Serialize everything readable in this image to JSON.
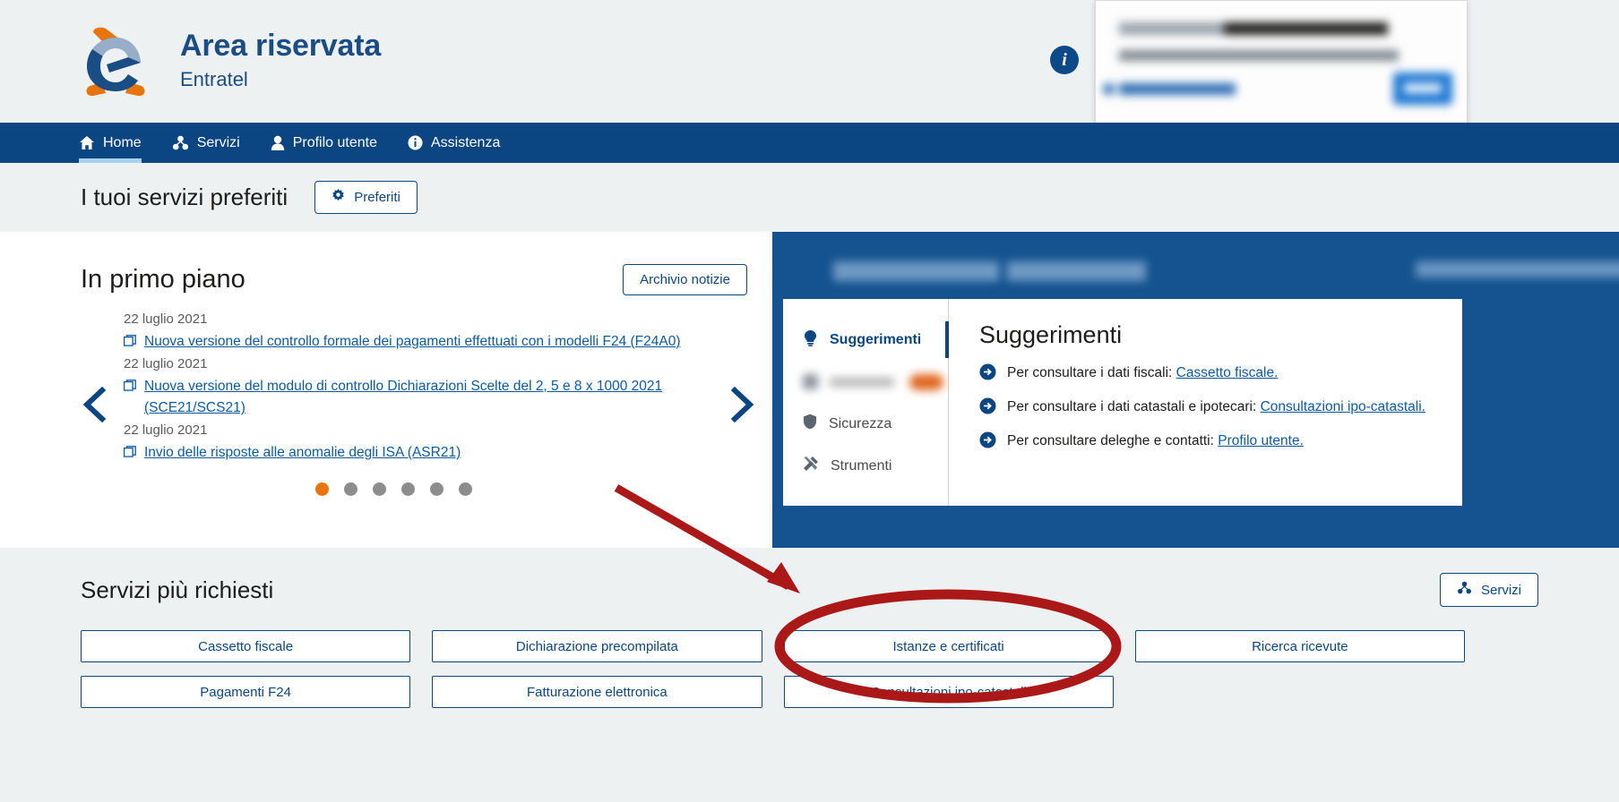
{
  "brand": {
    "title": "Area riservata",
    "subtitle": "Entratel",
    "logo_icon": "agenzia-entrate-logo",
    "info_icon": "info-icon"
  },
  "colors": {
    "nav_blue": "#0b4682",
    "panel_blue": "#14538f",
    "accent_orange": "#e8740c",
    "link_blue": "#0b5aa5",
    "page_grey": "#eef1f2",
    "annotation_red": "#ab1818"
  },
  "navbar": {
    "items": [
      {
        "label": "Home",
        "icon": "home-icon",
        "active": true
      },
      {
        "label": "Servizi",
        "icon": "services-icon",
        "active": false
      },
      {
        "label": "Profilo utente",
        "icon": "user-icon",
        "active": false
      },
      {
        "label": "Assistenza",
        "icon": "info-circle-icon",
        "active": false
      }
    ]
  },
  "favorites": {
    "title": "I tuoi servizi preferiti",
    "button_label": "Preferiti",
    "button_icon": "gear-icon"
  },
  "news": {
    "title": "In primo piano",
    "archive_button": "Archivio notizie",
    "items": [
      {
        "date": "22 luglio 2021",
        "link": "Nuova versione del controllo formale dei pagamenti effettuati con i modelli F24 (F24A0)"
      },
      {
        "date": "22 luglio 2021",
        "link": "Nuova versione del modulo di controllo Dichiarazioni Scelte del 2, 5 e 8 x 1000 2021 (SCE21/SCS21)"
      },
      {
        "date": "22 luglio 2021",
        "link": "Invio delle risposte alle anomalie degli ISA (ASR21)"
      }
    ],
    "prev_icon": "chevron-left-icon",
    "next_icon": "chevron-right-icon",
    "dots": {
      "count": 6,
      "active_index": 0
    }
  },
  "suggestions": {
    "nav": [
      {
        "label": "Suggerimenti",
        "icon": "lightbulb-icon",
        "active": true,
        "redacted": false
      },
      {
        "label": "",
        "icon": "redacted-icon",
        "active": false,
        "redacted": true
      },
      {
        "label": "Sicurezza",
        "icon": "shield-icon",
        "active": false,
        "redacted": false
      },
      {
        "label": "Strumenti",
        "icon": "tools-icon",
        "active": false,
        "redacted": false
      }
    ],
    "heading": "Suggerimenti",
    "rows": [
      {
        "icon": "arrow-right-circle-icon",
        "text": "Per consultare i dati fiscali: ",
        "link": "Cassetto fiscale."
      },
      {
        "icon": "arrow-right-circle-icon",
        "text": "Per consultare i dati catastali e ipotecari: ",
        "link": "Consultazioni ipo-catastali."
      },
      {
        "icon": "arrow-right-circle-icon",
        "text": "Per consultare deleghe e contatti: ",
        "link": "Profilo utente."
      }
    ]
  },
  "bottom": {
    "title": "Servizi più richiesti",
    "services_button": "Servizi",
    "services_button_icon": "services-icon",
    "buttons": [
      "Cassetto fiscale",
      "Dichiarazione precompilata",
      "Istanze e certificati",
      "Ricerca ricevute",
      "Pagamenti F24",
      "Fatturazione elettronica",
      "Consultazioni ipo-catastali",
      ""
    ],
    "highlighted_button": "Istanze e certificati"
  }
}
